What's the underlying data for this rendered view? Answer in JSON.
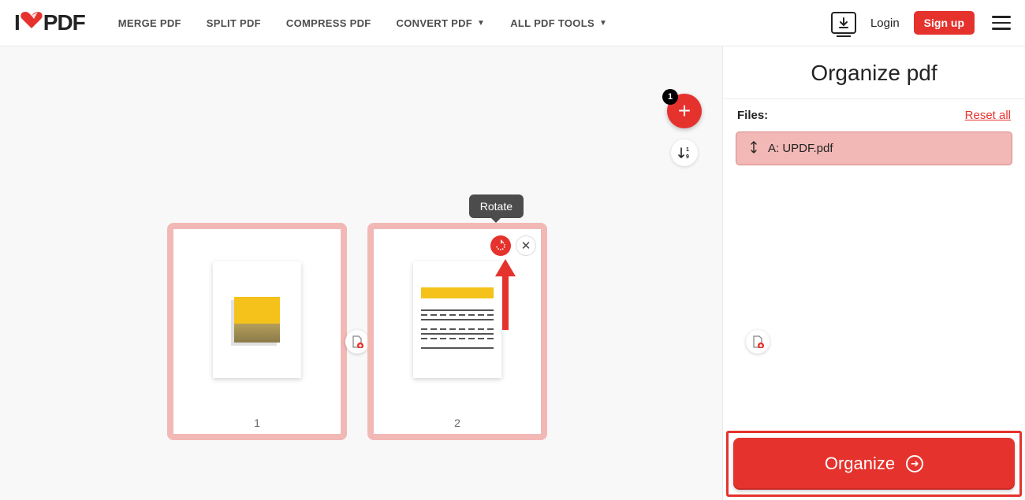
{
  "logo": {
    "part1": "I",
    "part2": "PDF"
  },
  "nav": {
    "merge": "MERGE PDF",
    "split": "SPLIT PDF",
    "compress": "COMPRESS PDF",
    "convert": "CONVERT PDF",
    "all": "ALL PDF TOOLS"
  },
  "header": {
    "login": "Login",
    "signup": "Sign up"
  },
  "sidebar": {
    "title": "Organize pdf",
    "files_label": "Files:",
    "reset": "Reset all",
    "file_a": "A: UPDF.pdf",
    "organize": "Organize"
  },
  "canvas": {
    "page1_num": "1",
    "page2_num": "2",
    "add_badge": "1",
    "tooltip": "Rotate"
  }
}
